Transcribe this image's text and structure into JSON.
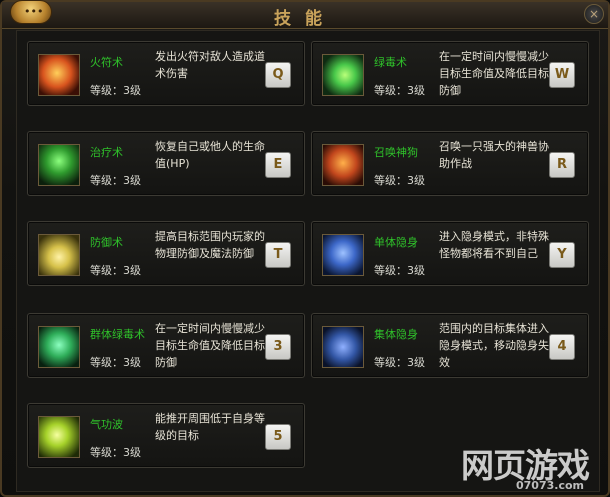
{
  "window": {
    "title": "技能",
    "close_label": "×",
    "chat_label": "•••"
  },
  "skills": [
    {
      "name": "火符术",
      "level_label": "等级：3级",
      "desc": "发出火符对敌人造成道术伤害",
      "key": "Q",
      "icon": "fire-talisman-icon",
      "accent": "#d8541e"
    },
    {
      "name": "绿毒术",
      "level_label": "等级：3级",
      "desc": "在一定时间内慢慢减少目标生命值及降低目标防御",
      "key": "W",
      "icon": "green-poison-icon",
      "accent": "#49c94a"
    },
    {
      "name": "治疗术",
      "level_label": "等级：3级",
      "desc": "恢复自己或他人的生命值(HP)",
      "key": "E",
      "icon": "heal-icon",
      "accent": "#3fcf43"
    },
    {
      "name": "召唤神狗",
      "level_label": "等级：3级",
      "desc": "召唤一只强大的神兽协助作战",
      "key": "R",
      "icon": "summon-beast-icon",
      "accent": "#e3672a"
    },
    {
      "name": "防御术",
      "level_label": "等级：3级",
      "desc": "提高目标范围内玩家的物理防御及魔法防御",
      "key": "T",
      "icon": "defense-icon",
      "accent": "#d6c14a"
    },
    {
      "name": "单体隐身",
      "level_label": "等级：3级",
      "desc": "进入隐身模式，非特殊怪物都将看不到自己",
      "key": "Y",
      "icon": "single-stealth-icon",
      "accent": "#4c7fe0"
    },
    {
      "name": "群体绿毒术",
      "level_label": "等级：3级",
      "desc": "在一定时间内慢慢减少目标生命值及降低目标防御",
      "key": "3",
      "icon": "group-poison-icon",
      "accent": "#3dc46a"
    },
    {
      "name": "集体隐身",
      "level_label": "等级：3级",
      "desc": "范围内的目标集体进入隐身模式，移动隐身失效",
      "key": "4",
      "icon": "group-stealth-icon",
      "accent": "#4a73c8"
    },
    {
      "name": "气功波",
      "level_label": "等级：3级",
      "desc": "能推开周围低于自身等级的目标",
      "key": "5",
      "icon": "qigong-wave-icon",
      "accent": "#b7e13a"
    }
  ],
  "watermark": {
    "text": "网页游戏",
    "url": "07073.com"
  }
}
